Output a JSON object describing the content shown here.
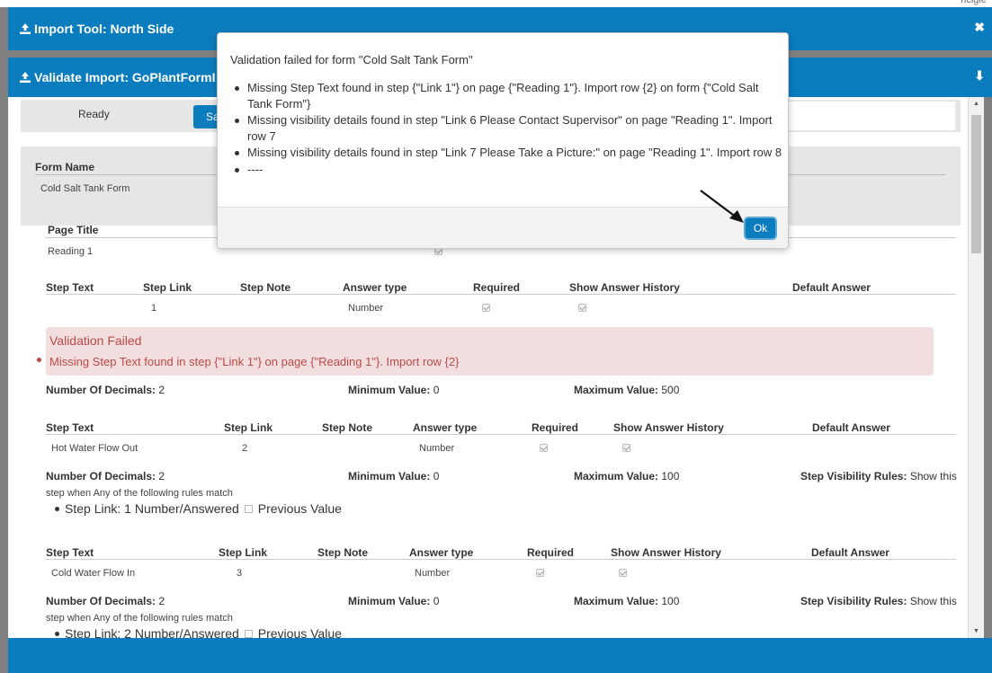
{
  "top_fragment": "ncigle",
  "outer_bar": {
    "title": "Import Tool: North Side",
    "close_glyph": "✖"
  },
  "inner_bar": {
    "title": "Validate Import: GoPlantFormI",
    "collapse_glyph": "⬇"
  },
  "status": {
    "ready_label": "Ready",
    "save_label": "Sa"
  },
  "form": {
    "header": "Form Name",
    "value": "Cold Salt Tank Form"
  },
  "page": {
    "header": "Page Title",
    "value": "Reading 1"
  },
  "step_headers": {
    "step_text": "Step Text",
    "step_link": "Step Link",
    "step_note": "Step Note",
    "answer_type": "Answer type",
    "required": "Required",
    "show_history": "Show Answer History",
    "default_answer": "Default Answer"
  },
  "steps": [
    {
      "text": "",
      "link": "1",
      "note": "",
      "answer_type": "Number"
    },
    {
      "text": "Hot Water Flow Out",
      "link": "2",
      "note": "",
      "answer_type": "Number"
    },
    {
      "text": "Cold Water Flow In",
      "link": "3",
      "note": "",
      "answer_type": "Number"
    }
  ],
  "validation": {
    "heading": "Validation Failed",
    "message": "Missing Step Text found in step {\"Link 1\"} on page {\"Reading 1\"}. Import row {2}"
  },
  "labels": {
    "decimals": "Number Of Decimals:",
    "min": "Minimum Value:",
    "max": "Maximum Value:",
    "visibility": "Step Visibility Rules:",
    "show_this": "Show this",
    "step_when": "step when Any of the following rules match",
    "previous_value": "Previous Value"
  },
  "step_details": [
    {
      "decimals": "2",
      "min": "0",
      "max": "500"
    },
    {
      "decimals": "2",
      "min": "0",
      "max": "100",
      "rule": "Step Link: 1 Number/Answered"
    },
    {
      "decimals": "2",
      "min": "0",
      "max": "100",
      "rule": "Step Link: 2 Number/Answered"
    }
  ],
  "modal": {
    "title": "Validation failed for form \"Cold Salt Tank Form\"",
    "items": [
      "Missing Step Text found in step {\"Link 1\"} on page {\"Reading 1\"}. Import row {2} on form {\"Cold Salt Tank Form\"}",
      "Missing visibility details found in step \"Link 6 Please Contact Supervisor\" on page \"Reading 1\". Import row 7",
      "Missing visibility details found in step \"Link 7 Please Take a Picture:\" on page \"Reading 1\". Import row 8",
      "----"
    ],
    "ok_label": "Ok"
  },
  "colors": {
    "brand": "#0b7dbf",
    "error_bg": "#f2dede",
    "error_text": "#b94a48"
  },
  "icons": {
    "upload": "upload-icon",
    "close": "close-icon",
    "collapse": "arrow-down-icon"
  }
}
